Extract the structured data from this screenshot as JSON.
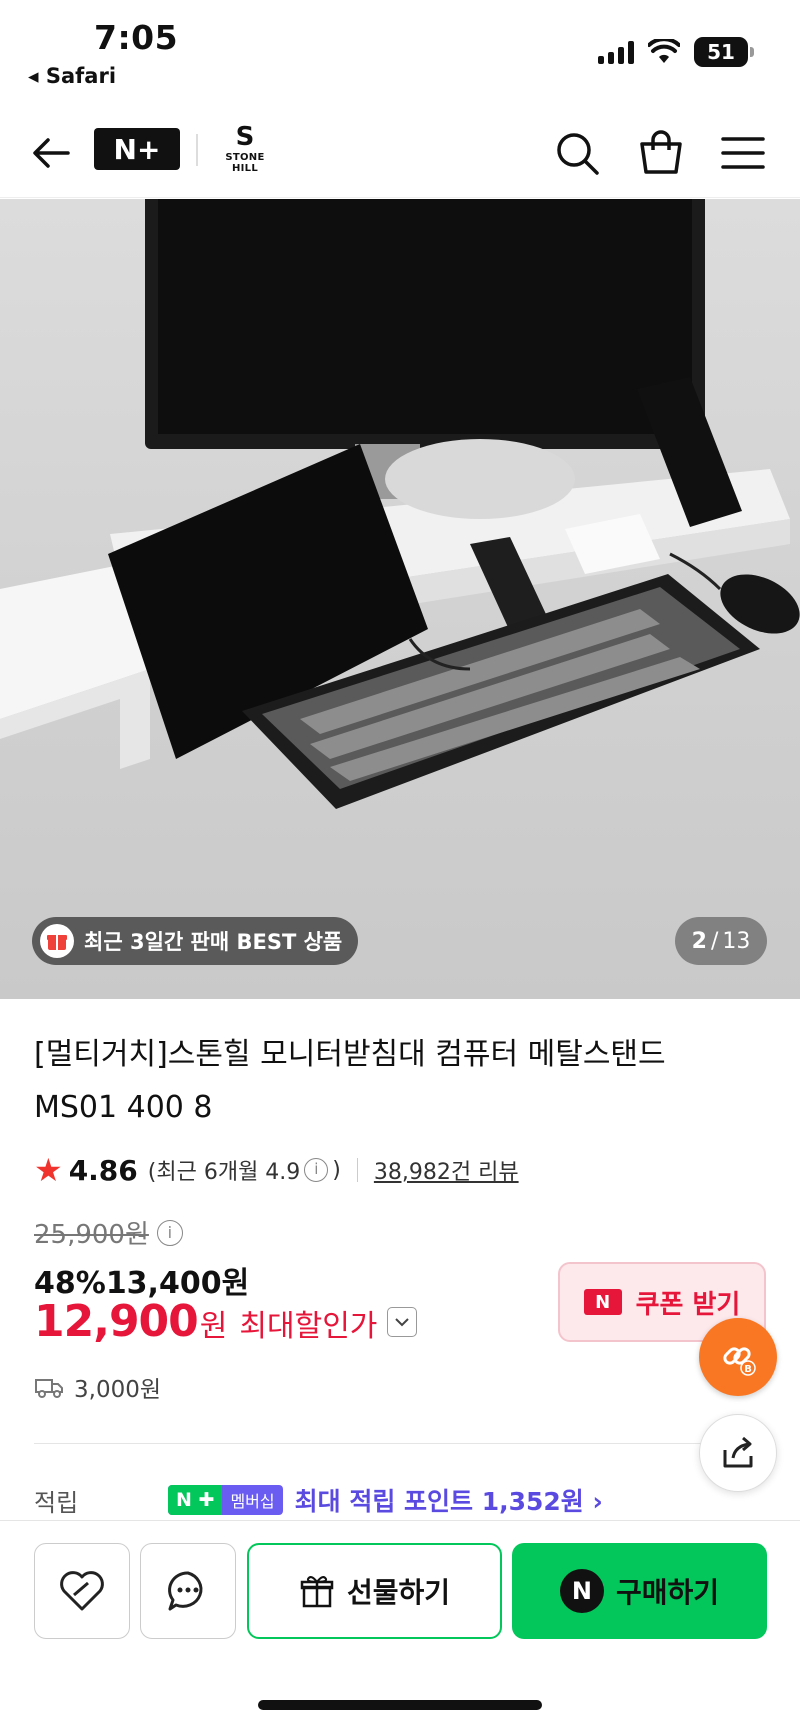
{
  "status": {
    "time": "7:05",
    "back_app": "Safari",
    "battery": "51"
  },
  "nav": {
    "logo_text": "N+",
    "brand_name": "STONE HILL",
    "brand_mark": "S"
  },
  "hero": {
    "best_badge": "최근 3일간 판매 BEST 상품",
    "counter_current": "2",
    "counter_total": "13"
  },
  "product": {
    "title": "[멀티거치]스톤힐 모니터받침대 컴퓨터 메탈스탠드 MS01 400 8",
    "rating": "4.86",
    "recent_rating": "(최근 6개월 4.9",
    "recent_rating_close": ")",
    "review_count": "38,982건 리뷰",
    "original_price": "25,900원",
    "discount": "48%",
    "sale_price": "13,400원",
    "max_price": "12,900",
    "max_price_unit": "원",
    "max_label": "최대할인가",
    "coupon_label": "쿠폰 받기",
    "coupon_tag": "N",
    "shipping": "3,000원",
    "points_label": "적립",
    "points_badge_n": "N ✚",
    "points_badge_member": "멤버십",
    "points_text": "최대 적립 포인트 1,352원 ›"
  },
  "bottom": {
    "gift_label": "선물하기",
    "buy_label": "구매하기",
    "buy_icon": "N"
  },
  "colors": {
    "accent_red": "#e6163a",
    "naver_green": "#03c75a",
    "points_purple": "#5a4ae0",
    "link_orange": "#f97722"
  }
}
